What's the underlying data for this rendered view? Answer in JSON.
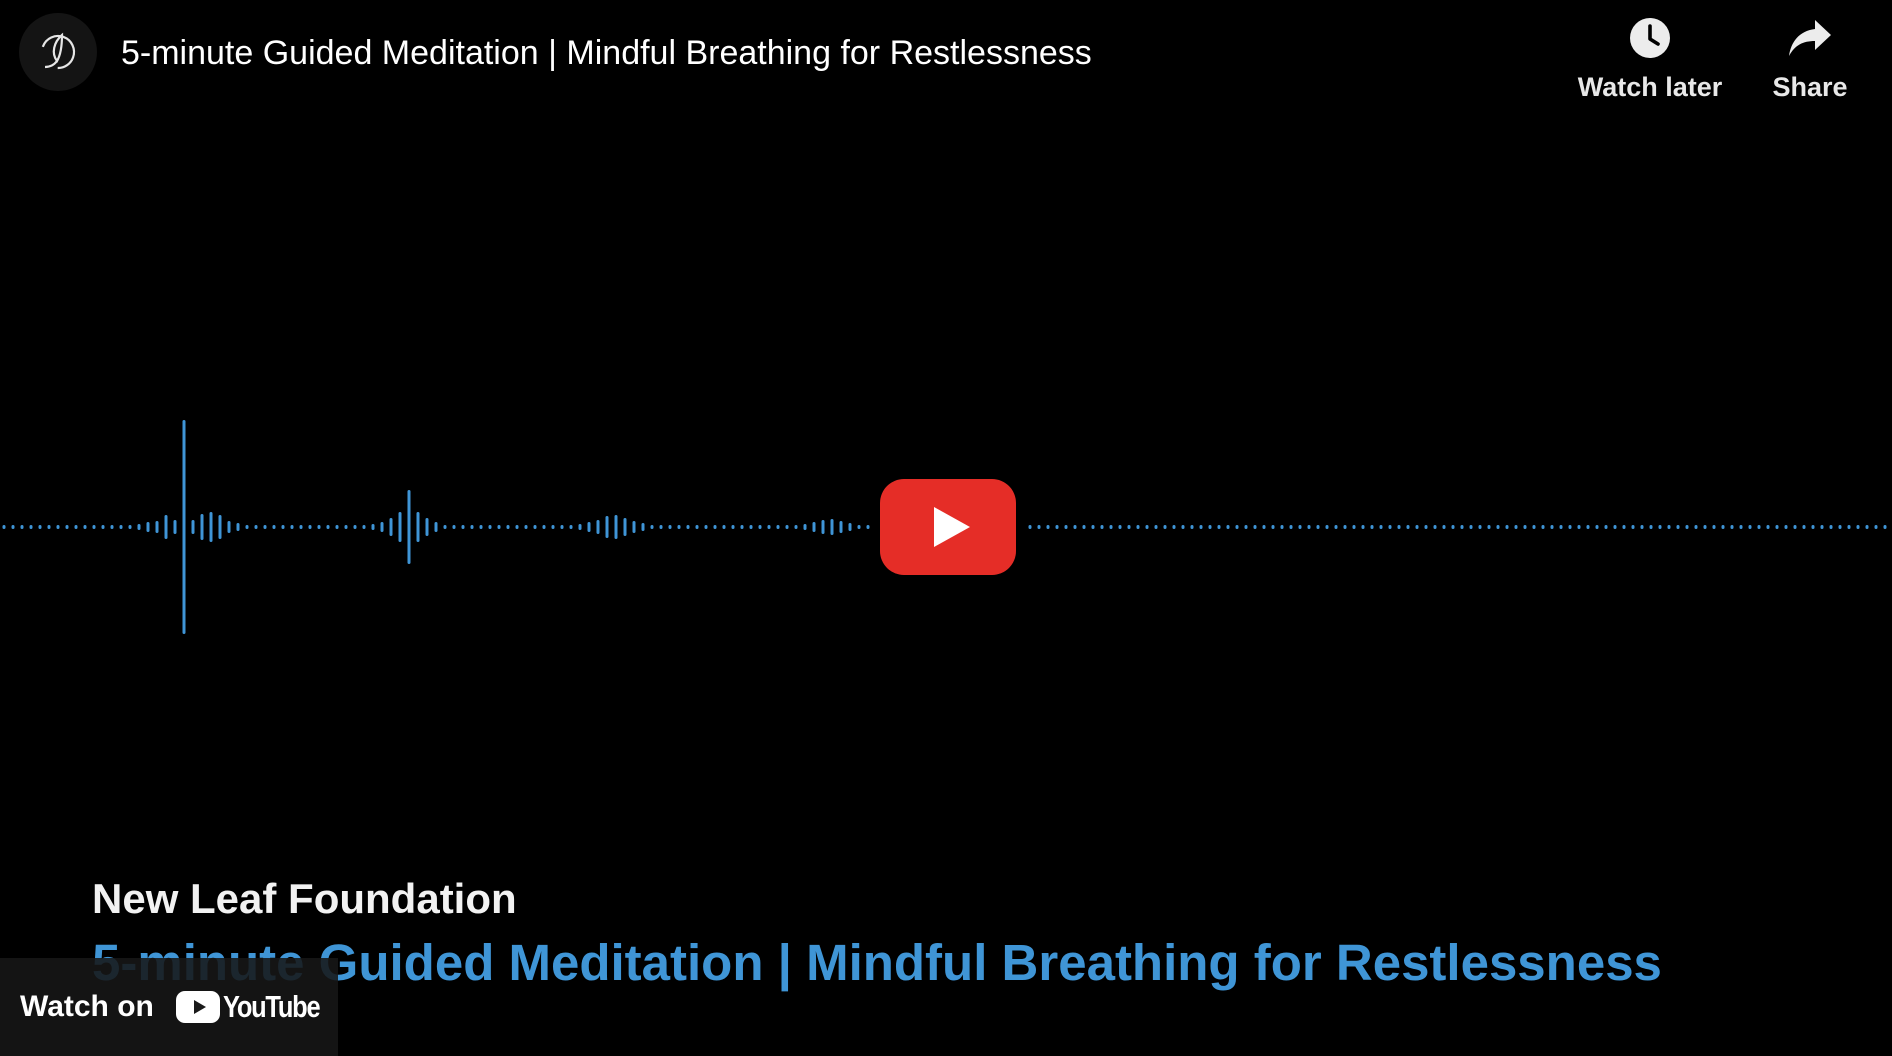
{
  "header": {
    "title": "5-minute Guided Meditation | Mindful Breathing for Restlessness",
    "channel_avatar_icon": "leaf-logo-icon",
    "watch_later_label": "Watch later",
    "watch_later_icon": "clock-icon",
    "share_label": "Share",
    "share_icon": "share-arrow-icon"
  },
  "video": {
    "channel_name": "New Leaf Foundation",
    "subtitle": "5-minute Guided Meditation | Mindful Breathing for Restlessness",
    "waveform_color": "#3f95d6",
    "subtitle_color": "#3f95d6",
    "play_icon": "play-icon",
    "play_button_color": "#e52d27"
  },
  "footer": {
    "watch_on_label": "Watch on",
    "youtube_label": "YouTube"
  }
}
